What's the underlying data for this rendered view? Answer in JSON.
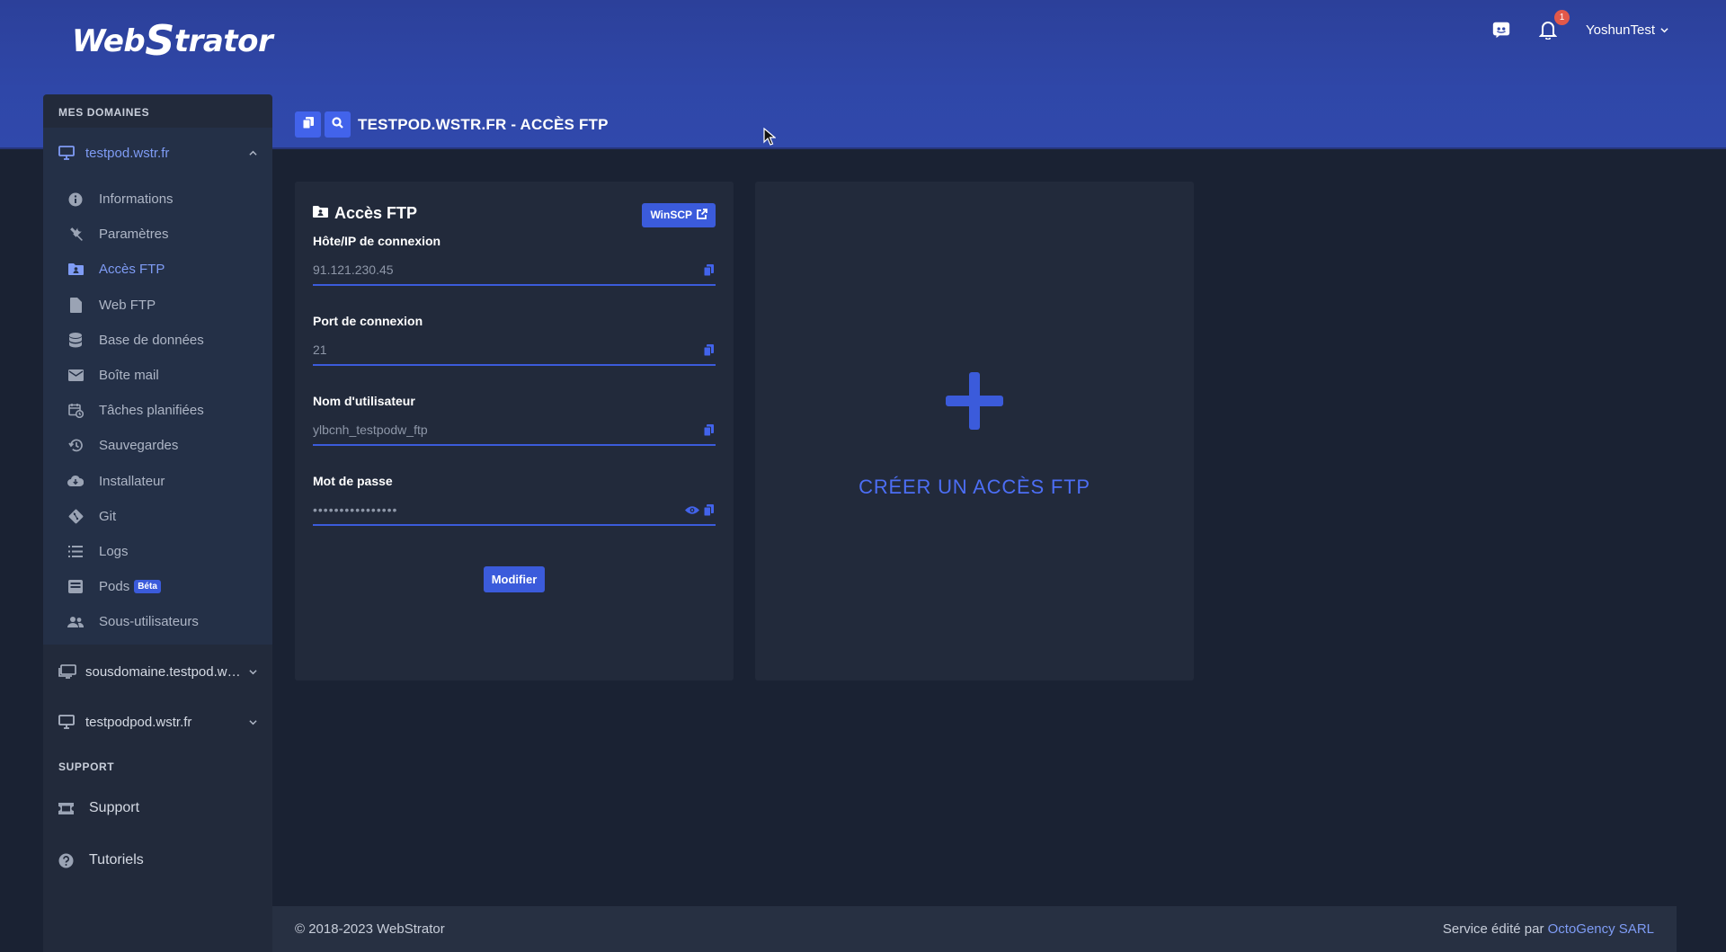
{
  "brand": {
    "logo_text_pre": "Web",
    "logo_text_s": "S",
    "logo_text_post": "trator"
  },
  "header": {
    "notifications_count": "1",
    "user_name": "YoshunTest"
  },
  "sidebar": {
    "section_domains": "MES DOMAINES",
    "active_domain": "testpod.wstr.fr",
    "items": [
      {
        "label": "Informations",
        "icon": "info-icon"
      },
      {
        "label": "Paramètres",
        "icon": "tools-icon"
      },
      {
        "label": "Accès FTP",
        "icon": "folder-user-icon"
      },
      {
        "label": "Web FTP",
        "icon": "file-icon"
      },
      {
        "label": "Base de données",
        "icon": "database-icon"
      },
      {
        "label": "Boîte mail",
        "icon": "envelope-icon"
      },
      {
        "label": "Tâches planifiées",
        "icon": "calendar-clock-icon"
      },
      {
        "label": "Sauvegardes",
        "icon": "history-icon"
      },
      {
        "label": "Installateur",
        "icon": "cloud-download-icon"
      },
      {
        "label": "Git",
        "icon": "git-icon"
      },
      {
        "label": "Logs",
        "icon": "list-icon"
      },
      {
        "label": "Pods",
        "icon": "pod-icon",
        "badge": "Béta"
      },
      {
        "label": "Sous-utilisateurs",
        "icon": "users-icon"
      }
    ],
    "other_domains": [
      "sousdomaine.testpod.wstr.fr",
      "testpodpod.wstr.fr"
    ],
    "section_support": "SUPPORT",
    "support_items": [
      {
        "label": "Support",
        "icon": "ticket-icon"
      },
      {
        "label": "Tutoriels",
        "icon": "question-icon"
      }
    ]
  },
  "page": {
    "title": "TESTPOD.WSTR.FR - ACCÈS FTP"
  },
  "ftp_card": {
    "title": "Accès FTP",
    "winscp_label": "WinSCP",
    "host_label": "Hôte/IP de connexion",
    "host_value": "91.121.230.45",
    "port_label": "Port de connexion",
    "port_value": "21",
    "user_label": "Nom d'utilisateur",
    "user_value": "ylbcnh_testpodw_ftp",
    "password_label": "Mot de passe",
    "password_value": "••••••••••••••••",
    "modify_label": "Modifier"
  },
  "create_card": {
    "label": "CRÉER UN ACCÈS FTP"
  },
  "footer": {
    "copyright": "© 2018-2023 WebStrator",
    "edited_by": "Service édité par",
    "company": "OctoGency SARL"
  },
  "colors": {
    "accent": "#3b5bdb",
    "active_text": "#7f9cf5",
    "background": "#1a2233",
    "card": "#222a3b",
    "header": "#2f47a8",
    "badge": "#e2584a"
  }
}
